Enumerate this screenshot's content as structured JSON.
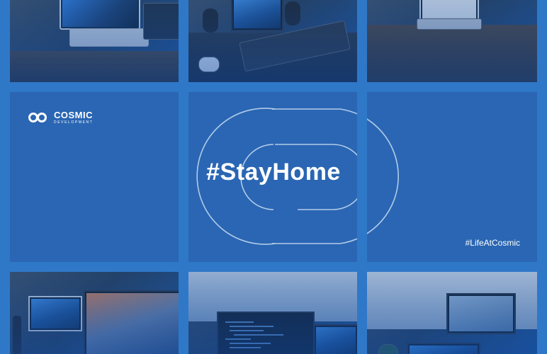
{
  "brand": {
    "name": "COSMIC",
    "tagline": "DEVELOPMENT"
  },
  "headline": "#StayHome",
  "hashtag": "#LifeAtCosmic",
  "colors": {
    "background": "#2f78c8",
    "tile_blue": "#2a66b3",
    "text": "#ffffff"
  },
  "icons": [
    "cosmic-logo-icon",
    "double-ring-outline-icon"
  ]
}
